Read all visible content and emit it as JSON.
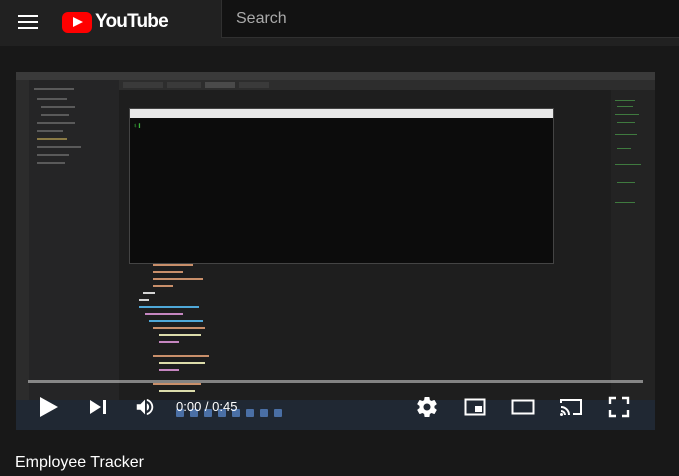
{
  "header": {
    "logo_text": "YouTube",
    "search_placeholder": "Search"
  },
  "player": {
    "time_current": "0:00",
    "time_separator": " / ",
    "time_total": "0:45",
    "progress_fraction": 0.0
  },
  "video": {
    "title": "Employee Tracker"
  },
  "icons": {
    "menu": "menu-icon",
    "play": "play-icon",
    "next": "next-icon",
    "volume": "volume-icon",
    "settings": "gear-icon",
    "miniplayer": "miniplayer-icon",
    "theater": "theater-mode-icon",
    "cast": "cast-icon",
    "fullscreen": "fullscreen-icon"
  },
  "colors": {
    "brand_red": "#ff0000",
    "background": "#181818",
    "header": "#212121"
  }
}
